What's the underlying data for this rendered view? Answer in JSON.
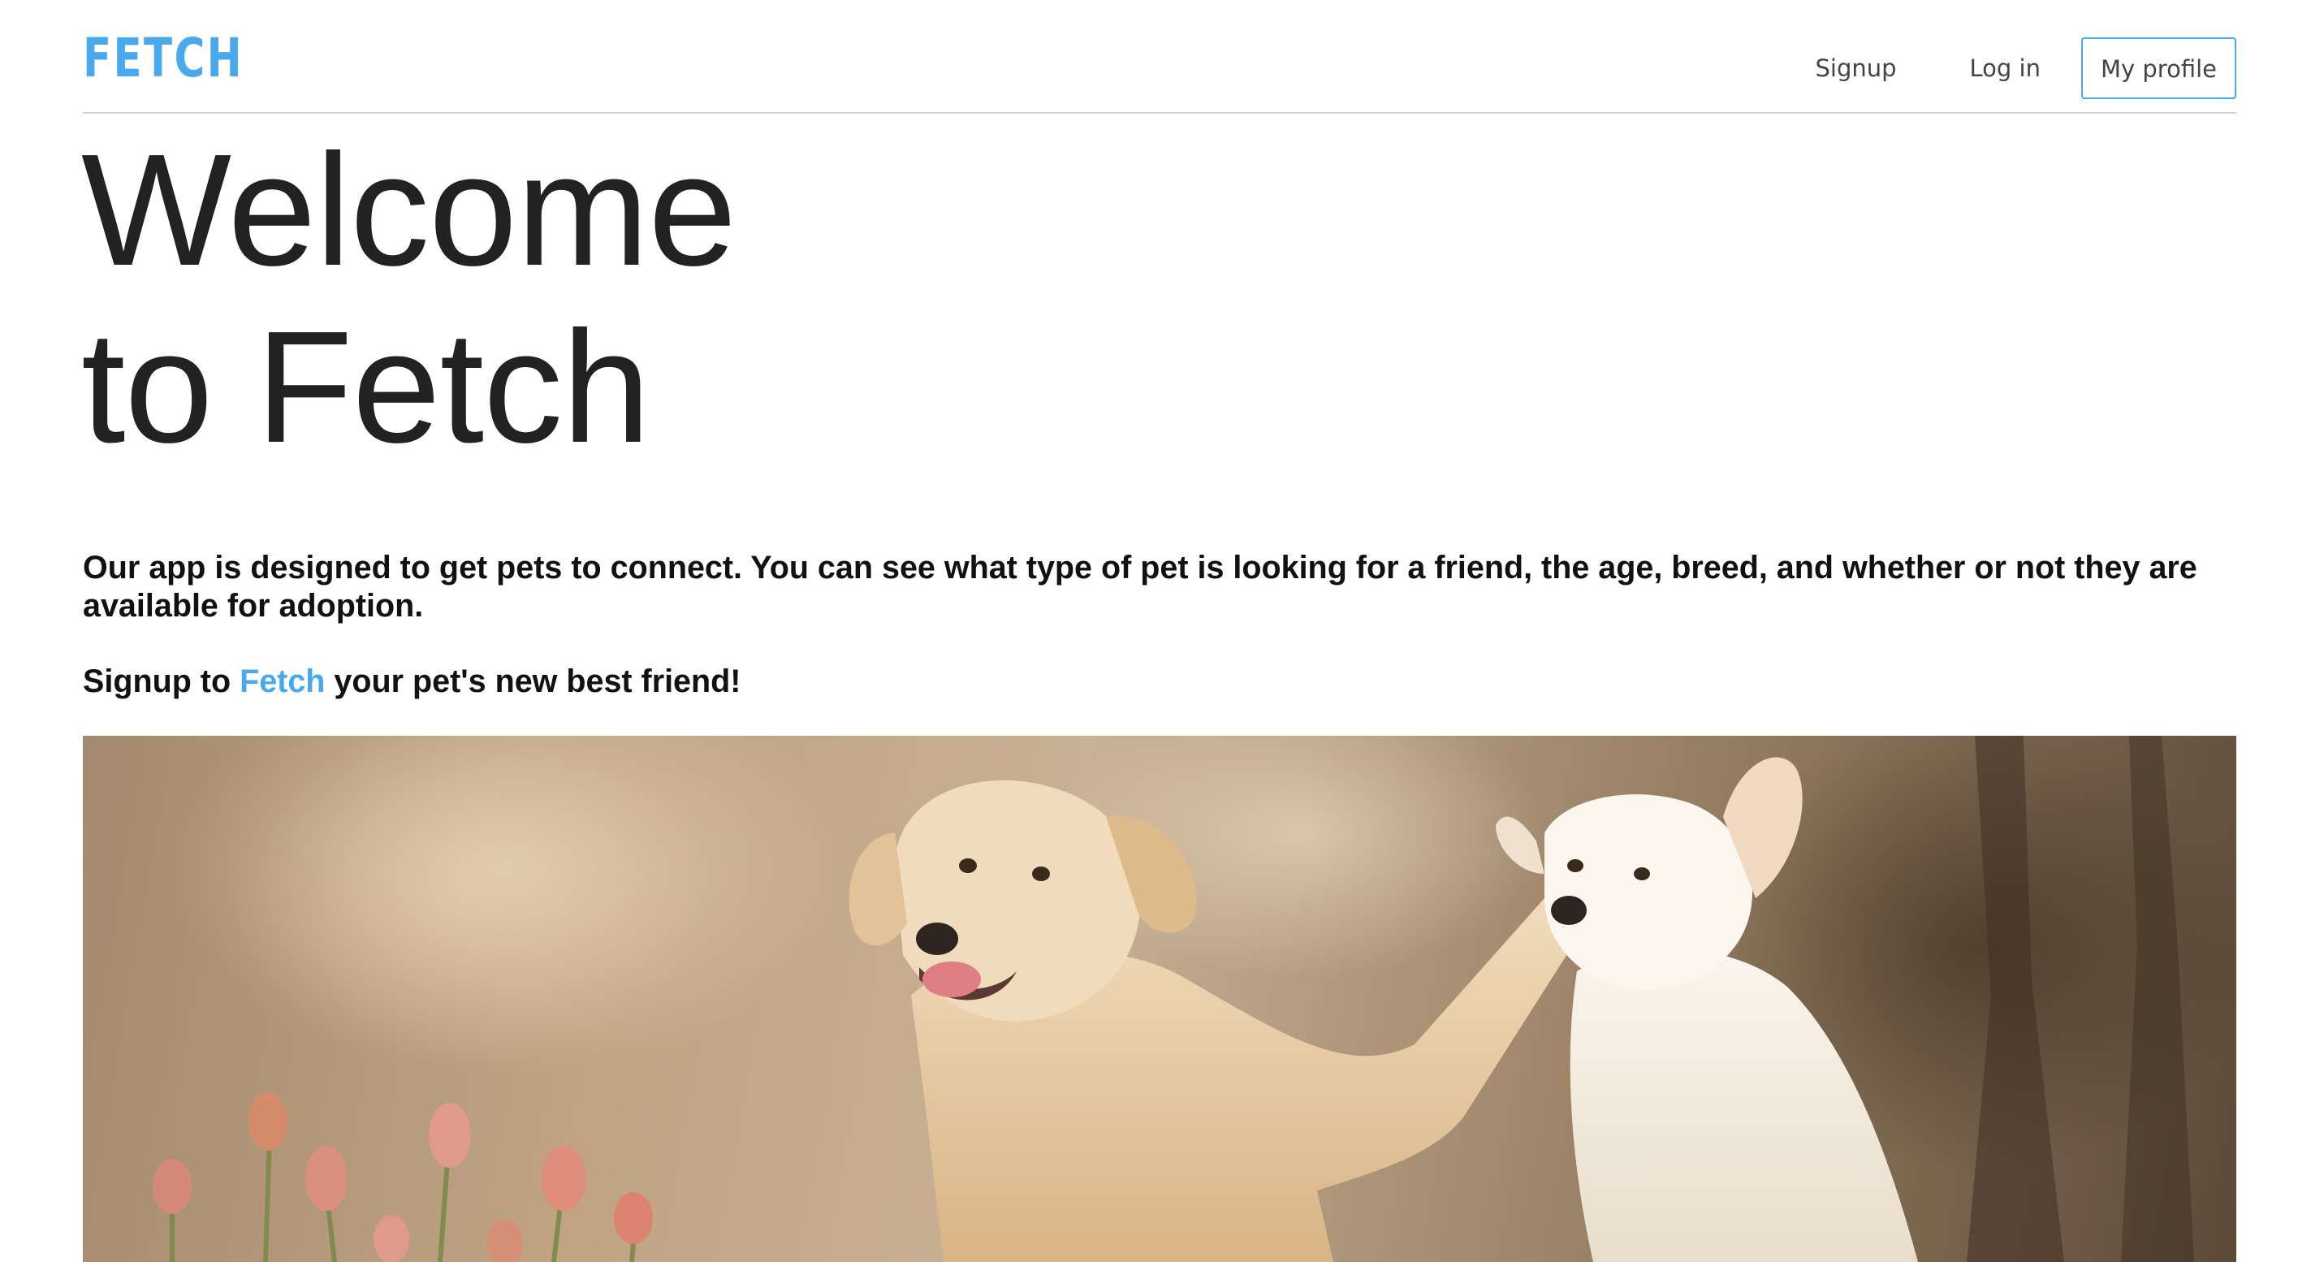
{
  "header": {
    "brand": "FETCH",
    "nav": {
      "signup": "Signup",
      "login": "Log in",
      "profile": "My profile"
    }
  },
  "hero": {
    "title_line1": "Welcome",
    "title_line2": "to Fetch"
  },
  "intro": {
    "text": "Our app is designed to get pets to connect. You can see what type of pet is looking for a friend, the age, breed, and whether or not they are available for adoption."
  },
  "cta": {
    "prefix": "Signup to ",
    "brand": "Fetch",
    "suffix": " your pet's new best friend!"
  },
  "colors": {
    "accent": "#4aa8ec",
    "text": "#222222",
    "divider": "#d4d4d4"
  }
}
